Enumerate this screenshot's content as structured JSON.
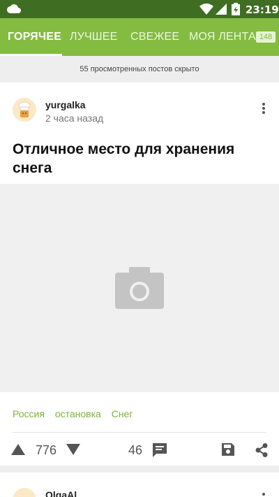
{
  "status_bar": {
    "time": "23:19"
  },
  "tabs": [
    {
      "label": "ГОРЯЧЕЕ"
    },
    {
      "label": "ЛУЧШЕЕ"
    },
    {
      "label": "СВЕЖЕЕ"
    },
    {
      "label": "МОЯ ЛЕНТА"
    }
  ],
  "tab_badge": "148",
  "hidden_note": "55 просмотренных постов скрыто",
  "post": {
    "author": "yurgalka",
    "time": "2 часа назад",
    "title": "Отличное место для хранения снега",
    "tags": [
      "Россия",
      "остановка",
      "Снег"
    ],
    "rating": "776",
    "comments": "46"
  },
  "next_post": {
    "author": "OlgaAl"
  },
  "colors": {
    "accent": "#83bc41",
    "status_bar": "#3f6e22",
    "tag": "#7ab339"
  }
}
